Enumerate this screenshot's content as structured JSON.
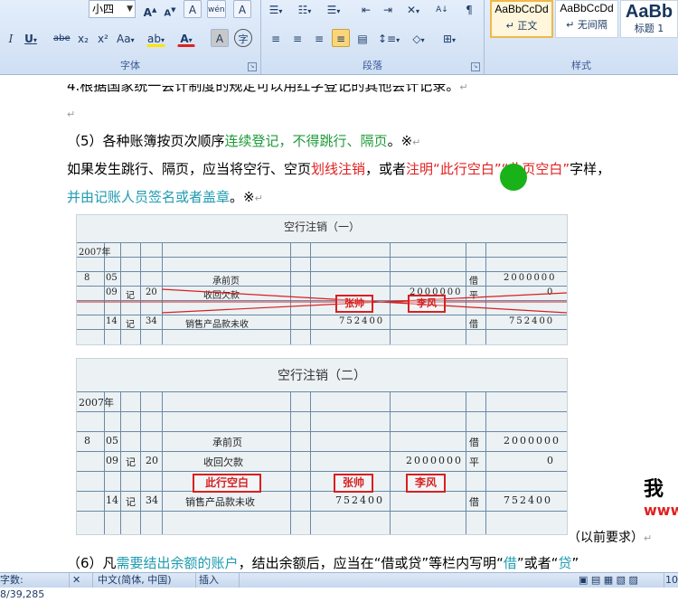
{
  "ribbon": {
    "font_group": {
      "label": "字体",
      "font_size_value": "小四",
      "grow_font": "A",
      "shrink_font": "A",
      "clear_format": "A",
      "phonetic": "wén",
      "char_border": "A",
      "italic": "I",
      "underline": "U",
      "strikethrough": "abe",
      "subscript": "x₂",
      "superscript": "x²",
      "change_case": "Aa",
      "highlight": "ab",
      "font_color": "A",
      "char_shading": "A",
      "enclose": "字"
    },
    "paragraph_group": {
      "label": "段落"
    },
    "styles_group": {
      "label": "样式",
      "tiles": [
        {
          "preview": "AaBbCcDd",
          "name": "↵ 正文"
        },
        {
          "preview": "AaBbCcDd",
          "name": "↵ 无间隔"
        },
        {
          "preview": "AaBb",
          "name": "标题 1"
        }
      ]
    }
  },
  "document": {
    "line0": "4.根据国家统一会计制度的规定可以用红字登记的其他会计记录。",
    "line1_a": "（5）各种账簿按页次顺序",
    "line1_b": "连续登记，不得跳行、隔页",
    "line1_c": "。※",
    "line2_a": "如果发生跳行、隔页，应当将空行、空页",
    "line2_b": "划线注销",
    "line2_c": "，或者",
    "line2_d": "注明“此行空白”“此页空白”",
    "line2_e": "字样，",
    "line3_a": "并由记账人员签名或者盖章",
    "line3_b": "。※",
    "ledger1": {
      "title": "空行注销（一）",
      "year": "2007年",
      "rows": [
        {
          "m": "8",
          "d": "05",
          "kind": "",
          "no": "",
          "summary": "承前页",
          "debit": "",
          "credit": "",
          "dir": "借",
          "balance": "2000000"
        },
        {
          "m": "",
          "d": "09",
          "kind": "记",
          "no": "20",
          "summary": "收回欠款",
          "debit": "",
          "credit": "2000000",
          "dir": "平",
          "balance": "0"
        },
        {
          "m": "",
          "d": "14",
          "kind": "记",
          "no": "34",
          "summary": "销售产品款未收",
          "debit": "752400",
          "credit": "",
          "dir": "借",
          "balance": "752400"
        }
      ],
      "stamp1": "张帅",
      "stamp2": "李风"
    },
    "ledger2": {
      "title": "空行注销（二）",
      "year": "2007年",
      "rows": [
        {
          "m": "8",
          "d": "05",
          "kind": "",
          "no": "",
          "summary": "承前页",
          "debit": "",
          "credit": "",
          "dir": "借",
          "balance": "2000000"
        },
        {
          "m": "",
          "d": "09",
          "kind": "记",
          "no": "20",
          "summary": "收回欠款",
          "debit": "",
          "credit": "2000000",
          "dir": "平",
          "balance": "0"
        },
        {
          "m": "",
          "d": "14",
          "kind": "记",
          "no": "34",
          "summary": "销售产品款未收",
          "debit": "752400",
          "credit": "",
          "dir": "借",
          "balance": "752400"
        }
      ],
      "stamp_blank": "此行空白",
      "stamp1": "张帅",
      "stamp2": "李风"
    },
    "note_previous": "（以前要求）",
    "line_last_a": "（6）凡",
    "line_last_b": "需要结出余额的账户",
    "line_last_c": "，结出余额后，应当在“借或贷”等栏内写明“",
    "line_last_d": "借",
    "line_last_e": "”或者“",
    "line_last_f": "贷",
    "line_last_g": "”",
    "watermark": "我",
    "watermark2": "www"
  },
  "status": {
    "words": "字数: 8/39,285",
    "lang": "中文(简体, 中国)",
    "mode": "插入",
    "zoom": "10"
  },
  "colors": {
    "green": "#1f9b3a",
    "red": "#e02020",
    "cyan": "#1f9bb0"
  }
}
